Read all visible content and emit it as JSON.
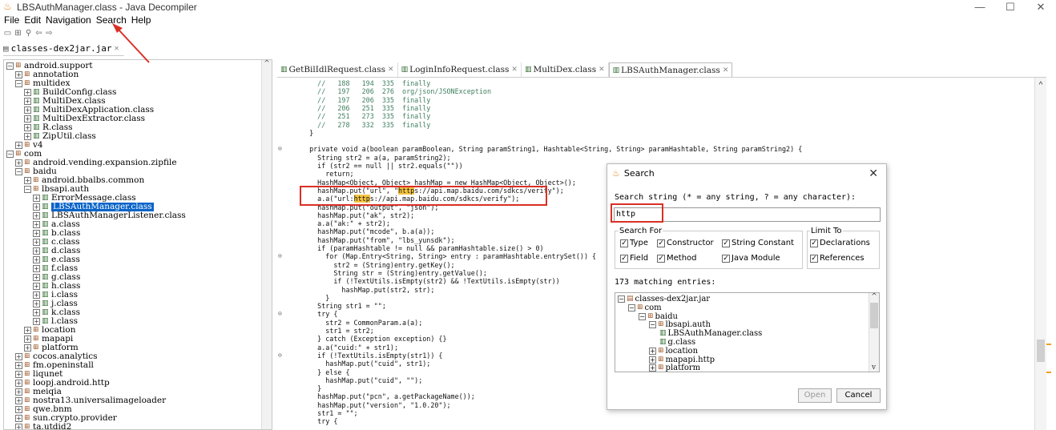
{
  "window": {
    "title": "LBSAuthManager.class - Java Decompiler",
    "controls": [
      "—",
      "☐",
      "✕"
    ]
  },
  "menu": [
    "File",
    "Edit",
    "Navigation",
    "Search",
    "Help"
  ],
  "file_tab": {
    "label": "classes-dex2jar.jar"
  },
  "tree": [
    {
      "label": "android.support",
      "depth": 0,
      "toggle": "⊟",
      "type": "pkg"
    },
    {
      "label": "annotation",
      "depth": 1,
      "toggle": "⊞",
      "type": "pkg"
    },
    {
      "label": "multidex",
      "depth": 1,
      "toggle": "⊟",
      "type": "pkg"
    },
    {
      "label": "BuildConfig.class",
      "depth": 2,
      "toggle": "⊞",
      "type": "cls"
    },
    {
      "label": "MultiDex.class",
      "depth": 2,
      "toggle": "⊞",
      "type": "cls"
    },
    {
      "label": "MultiDexApplication.class",
      "depth": 2,
      "toggle": "⊞",
      "type": "cls"
    },
    {
      "label": "MultiDexExtractor.class",
      "depth": 2,
      "toggle": "⊞",
      "type": "cls"
    },
    {
      "label": "R.class",
      "depth": 2,
      "toggle": "⊞",
      "type": "cls"
    },
    {
      "label": "ZipUtil.class",
      "depth": 2,
      "toggle": "⊞",
      "type": "cls"
    },
    {
      "label": "v4",
      "depth": 1,
      "toggle": "⊞",
      "type": "pkg"
    },
    {
      "label": "com",
      "depth": 0,
      "toggle": "⊟",
      "type": "pkg"
    },
    {
      "label": "android.vending.expansion.zipfile",
      "depth": 1,
      "toggle": "⊞",
      "type": "pkg"
    },
    {
      "label": "baidu",
      "depth": 1,
      "toggle": "⊟",
      "type": "pkg"
    },
    {
      "label": "android.bbalbs.common",
      "depth": 2,
      "toggle": "⊞",
      "type": "pkg"
    },
    {
      "label": "lbsapi.auth",
      "depth": 2,
      "toggle": "⊟",
      "type": "pkg"
    },
    {
      "label": "ErrorMessage.class",
      "depth": 3,
      "toggle": "⊞",
      "type": "cls"
    },
    {
      "label": "LBSAuthManager.class",
      "depth": 3,
      "toggle": "⊞",
      "type": "cls",
      "selected": true
    },
    {
      "label": "LBSAuthManagerListener.class",
      "depth": 3,
      "toggle": "⊞",
      "type": "cls"
    },
    {
      "label": "a.class",
      "depth": 3,
      "toggle": "⊞",
      "type": "cls"
    },
    {
      "label": "b.class",
      "depth": 3,
      "toggle": "⊞",
      "type": "cls"
    },
    {
      "label": "c.class",
      "depth": 3,
      "toggle": "⊞",
      "type": "cls"
    },
    {
      "label": "d.class",
      "depth": 3,
      "toggle": "⊞",
      "type": "cls"
    },
    {
      "label": "e.class",
      "depth": 3,
      "toggle": "⊞",
      "type": "cls"
    },
    {
      "label": "f.class",
      "depth": 3,
      "toggle": "⊞",
      "type": "cls"
    },
    {
      "label": "g.class",
      "depth": 3,
      "toggle": "⊞",
      "type": "cls"
    },
    {
      "label": "h.class",
      "depth": 3,
      "toggle": "⊞",
      "type": "cls"
    },
    {
      "label": "i.class",
      "depth": 3,
      "toggle": "⊞",
      "type": "cls"
    },
    {
      "label": "j.class",
      "depth": 3,
      "toggle": "⊞",
      "type": "cls"
    },
    {
      "label": "k.class",
      "depth": 3,
      "toggle": "⊞",
      "type": "cls"
    },
    {
      "label": "l.class",
      "depth": 3,
      "toggle": "⊞",
      "type": "cls"
    },
    {
      "label": "location",
      "depth": 2,
      "toggle": "⊞",
      "type": "pkg"
    },
    {
      "label": "mapapi",
      "depth": 2,
      "toggle": "⊞",
      "type": "pkg"
    },
    {
      "label": "platform",
      "depth": 2,
      "toggle": "⊞",
      "type": "pkg"
    },
    {
      "label": "cocos.analytics",
      "depth": 1,
      "toggle": "⊞",
      "type": "pkg"
    },
    {
      "label": "fm.openinstall",
      "depth": 1,
      "toggle": "⊞",
      "type": "pkg"
    },
    {
      "label": "liqunet",
      "depth": 1,
      "toggle": "⊞",
      "type": "pkg"
    },
    {
      "label": "loopj.android.http",
      "depth": 1,
      "toggle": "⊞",
      "type": "pkg"
    },
    {
      "label": "meiqia",
      "depth": 1,
      "toggle": "⊞",
      "type": "pkg"
    },
    {
      "label": "nostra13.universalimageloader",
      "depth": 1,
      "toggle": "⊞",
      "type": "pkg"
    },
    {
      "label": "qwe.bnm",
      "depth": 1,
      "toggle": "⊞",
      "type": "pkg"
    },
    {
      "label": "sun.crypto.provider",
      "depth": 1,
      "toggle": "⊞",
      "type": "pkg"
    },
    {
      "label": "ta.utdid2",
      "depth": 1,
      "toggle": "⊞",
      "type": "pkg"
    }
  ],
  "editor_tabs": [
    {
      "label": "GetBilIdlRequest.class",
      "active": false
    },
    {
      "label": "LoginInfoRequest.class",
      "active": false
    },
    {
      "label": "MultiDex.class",
      "active": false
    },
    {
      "label": "LBSAuthManager.class",
      "active": true
    }
  ],
  "code_lines": [
    "    //   188   194  335  finally",
    "    //   197   206  276  org/json/JSONException",
    "    //   197   206  335  finally",
    "    //   206   251  335  finally",
    "    //   251   273  335  finally",
    "    //   278   332  335  finally",
    "  }",
    "",
    "  private void a(boolean paramBoolean, String paramString1, Hashtable<String, String> paramHashtable, String paramString2) {",
    "    String str2 = a(a, paramString2);",
    "    if (str2 == null || str2.equals(\"\"))",
    "      return;",
    "    HashMap<Object, Object> hashMap = new HashMap<Object, Object>();",
    "    hashMap.put(\"url\", \"https://api.map.baidu.com/sdkcs/verify\");",
    "    a.a(\"url:https://api.map.baidu.com/sdkcs/verify\");",
    "    hashMap.put(\"output\", \"json\");",
    "    hashMap.put(\"ak\", str2);",
    "    a.a(\"ak:\" + str2);",
    "    hashMap.put(\"mcode\", b.a(a));",
    "    hashMap.put(\"from\", \"lbs_yunsdk\");",
    "    if (paramHashtable != null && paramHashtable.size() > 0)",
    "      for (Map.Entry<String, String> entry : paramHashtable.entrySet()) {",
    "        str2 = (String)entry.getKey();",
    "        String str = (String)entry.getValue();",
    "        if (!TextUtils.isEmpty(str2) && !TextUtils.isEmpty(str))",
    "          hashMap.put(str2, str);",
    "      }",
    "    String str1 = \"\";",
    "    try {",
    "      str2 = CommonParam.a(a);",
    "      str1 = str2;",
    "    } catch (Exception exception) {}",
    "    a.a(\"cuid:\" + str1);",
    "    if (!TextUtils.isEmpty(str1)) {",
    "      hashMap.put(\"cuid\", str1);",
    "    } else {",
    "      hashMap.put(\"cuid\", \"\");",
    "    }",
    "    hashMap.put(\"pcn\", a.getPackageName());",
    "    hashMap.put(\"version\", \"1.0.20\");",
    "    str1 = \"\";",
    "    try {"
  ],
  "search_dialog": {
    "title": "Search",
    "close": "✕",
    "label": "Search string (* = any string, ? = any character):",
    "value": "http",
    "search_for_title": "Search For",
    "limit_to_title": "Limit To",
    "search_for": [
      {
        "label": "Type",
        "checked": true
      },
      {
        "label": "Constructor",
        "checked": true
      },
      {
        "label": "String Constant",
        "checked": true
      },
      {
        "label": "Field",
        "checked": true
      },
      {
        "label": "Method",
        "checked": true
      },
      {
        "label": "Java Module",
        "checked": true
      }
    ],
    "limit_to": [
      {
        "label": "Declarations",
        "checked": true
      },
      {
        "label": "References",
        "checked": true
      }
    ],
    "matches": "173 matching entries:",
    "results": [
      {
        "label": "classes-dex2jar.jar",
        "depth": 0,
        "toggle": "⊟",
        "type": "jar"
      },
      {
        "label": "com",
        "depth": 1,
        "toggle": "⊟",
        "type": "pkg"
      },
      {
        "label": "baidu",
        "depth": 2,
        "toggle": "⊟",
        "type": "pkg"
      },
      {
        "label": "lbsapi.auth",
        "depth": 3,
        "toggle": "⊟",
        "type": "pkg"
      },
      {
        "label": "LBSAuthManager.class",
        "depth": 4,
        "toggle": "",
        "type": "cls"
      },
      {
        "label": "g.class",
        "depth": 4,
        "toggle": "",
        "type": "cls"
      },
      {
        "label": "location",
        "depth": 3,
        "toggle": "⊞",
        "type": "pkg"
      },
      {
        "label": "mapapi.http",
        "depth": 3,
        "toggle": "⊞",
        "type": "pkg"
      },
      {
        "label": "platform",
        "depth": 3,
        "toggle": "⊞",
        "type": "pkg"
      }
    ],
    "open_label": "Open",
    "cancel_label": "Cancel"
  },
  "colors": {
    "selection": "#0a64c8",
    "annotation_red": "#d93025",
    "highlight": "#f5c542",
    "keyword": "#7f0055",
    "string": "#2a00ff",
    "comment": "#3f7f5f"
  }
}
